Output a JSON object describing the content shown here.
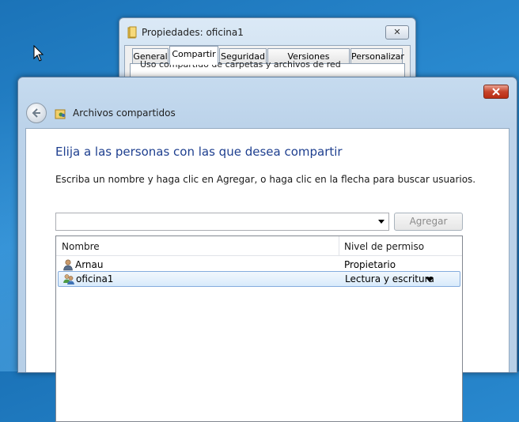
{
  "properties_window": {
    "title": "Propiedades: oficina1",
    "close_label": "✕",
    "tabs": [
      "General",
      "Compartir",
      "Seguridad",
      "Versiones anteriores",
      "Personalizar"
    ],
    "active_tab": "Compartir",
    "partial_text": "Uso compartido de carpetas y archivos de red"
  },
  "share_window": {
    "title": "Archivos compartidos",
    "heading": "Elija a las personas con las que desea compartir",
    "instruction": "Escriba un nombre y haga clic en Agregar, o haga clic en la flecha para buscar usuarios.",
    "input_value": "",
    "add_button": "Agregar",
    "columns": [
      "Nombre",
      "Nivel de permiso"
    ],
    "rows": [
      {
        "name": "Arnau",
        "permission": "Propietario",
        "icon": "user-icon",
        "selected": false
      },
      {
        "name": "oficina1",
        "permission": "Lectura y escritura",
        "icon": "group-icon",
        "selected": true
      }
    ]
  }
}
